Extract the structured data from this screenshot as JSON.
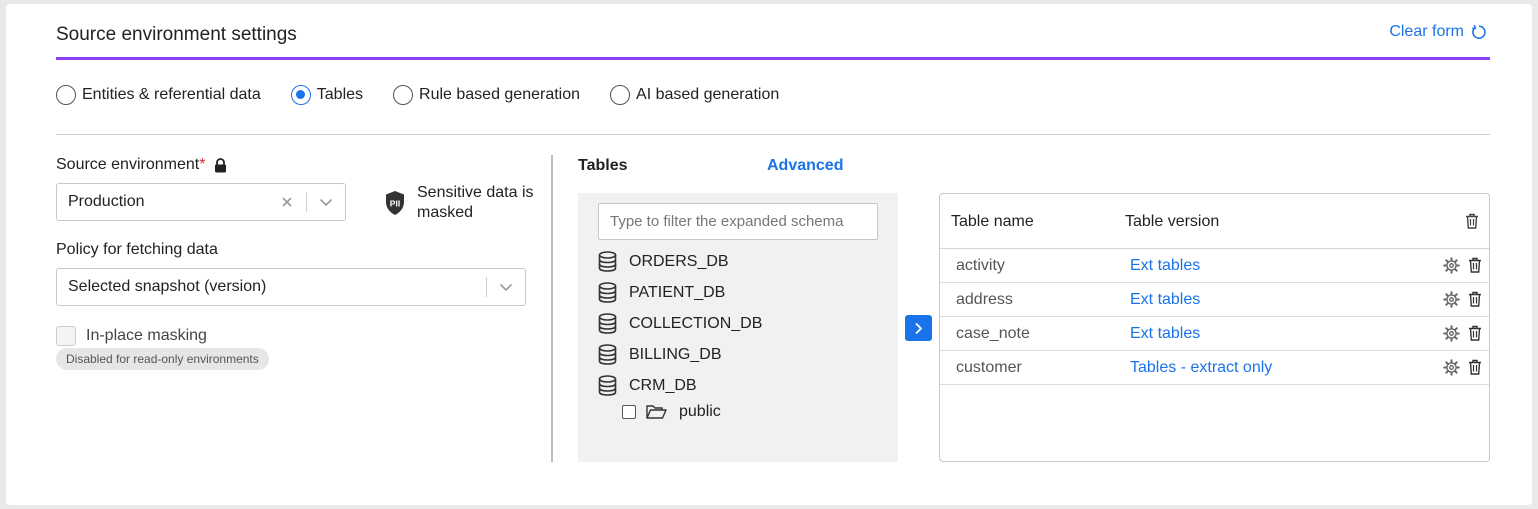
{
  "header": {
    "title": "Source environment settings",
    "clear_form": "Clear form"
  },
  "modes": [
    {
      "label": "Entities & referential data",
      "checked": false
    },
    {
      "label": "Tables",
      "checked": true
    },
    {
      "label": "Rule based generation",
      "checked": false
    },
    {
      "label": "AI based generation",
      "checked": false
    }
  ],
  "left": {
    "source_env_label": "Source environment",
    "required_mark": "*",
    "source_env_value": "Production",
    "pii_badge": "PII",
    "sensitive_note": "Sensitive data is masked",
    "policy_label": "Policy for fetching data",
    "policy_value": "Selected snapshot (version)",
    "inplace_label": "In-place masking",
    "inplace_note": "Disabled for read-only environments"
  },
  "tables_panel": {
    "label": "Tables",
    "advanced": "Advanced",
    "filter_placeholder": "Type to filter the expanded schema",
    "databases": [
      "ORDERS_DB",
      "PATIENT_DB",
      "COLLECTION_DB",
      "BILLING_DB",
      "CRM_DB"
    ],
    "schema_item": "public"
  },
  "selected_table": {
    "col_name": "Table name",
    "col_version": "Table version",
    "rows": [
      {
        "name": "activity",
        "version": "Ext tables"
      },
      {
        "name": "address",
        "version": "Ext tables"
      },
      {
        "name": "case_note",
        "version": "Ext tables"
      },
      {
        "name": "customer",
        "version": "Tables - extract only"
      }
    ]
  },
  "colors": {
    "accent": "#1a73e8",
    "purple": "#8a3ffc",
    "required": "#d32f2f"
  }
}
